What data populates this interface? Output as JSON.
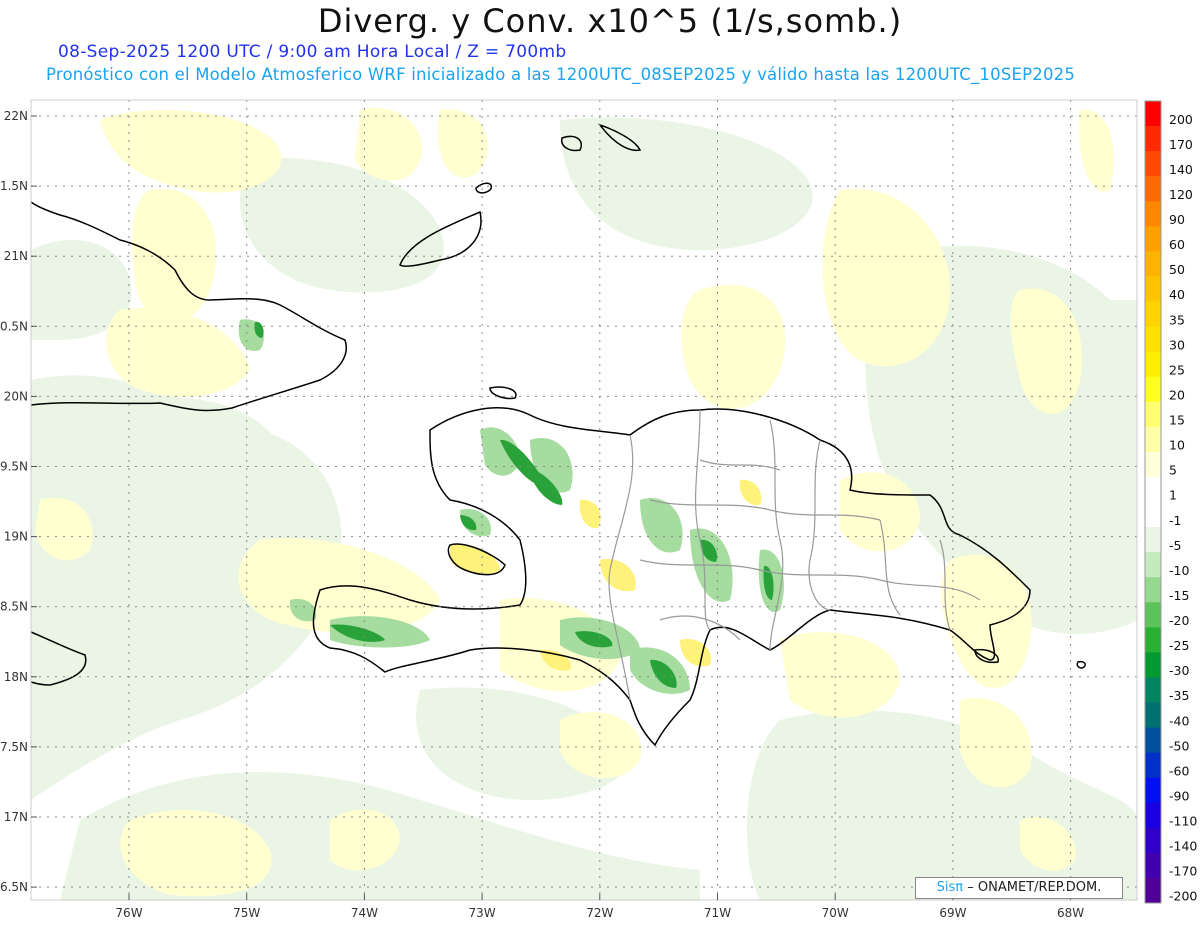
{
  "header": {
    "title": "Diverg. y Conv. x10^5 (1/s,somb.)",
    "line1": "08-Sep-2025  1200 UTC / 9:00 am Hora Local / Z = 700mb",
    "line2": "Pronóstico con el Modelo Atmosferico WRF inicializado a las 1200UTC_08SEP2025 y válido hasta las  1200UTC_10SEP2025"
  },
  "axes": {
    "lat_labels": [
      "22N",
      "1.5N",
      "21N",
      "0.5N",
      "20N",
      "9.5N",
      "19N",
      "8.5N",
      "18N",
      "7.5N",
      "17N",
      "6.5N"
    ],
    "lon_labels": [
      "76W",
      "75W",
      "74W",
      "73W",
      "72W",
      "71W",
      "70W",
      "69W",
      "68W"
    ]
  },
  "colorbar": {
    "labels": [
      "200",
      "170",
      "140",
      "120",
      "90",
      "60",
      "50",
      "40",
      "35",
      "30",
      "25",
      "20",
      "15",
      "10",
      "5",
      "1",
      "-1",
      "-5",
      "-10",
      "-15",
      "-20",
      "-25",
      "-30",
      "-35",
      "-40",
      "-50",
      "-60",
      "-90",
      "-110",
      "-140",
      "-170",
      "-200"
    ],
    "colors": [
      "#ff0000",
      "#ff2a00",
      "#ff4a00",
      "#ff6a00",
      "#ff8800",
      "#ffa000",
      "#ffb300",
      "#ffc400",
      "#ffd400",
      "#ffe000",
      "#ffee00",
      "#ffff20",
      "#ffff70",
      "#ffffa8",
      "#ffffd8",
      "#ffffff",
      "#ffffff",
      "#eaf5e5",
      "#c5eac0",
      "#95d98f",
      "#5cc45a",
      "#28b032",
      "#009a30",
      "#008560",
      "#007070",
      "#0050a0",
      "#0030c8",
      "#0010f0",
      "#1a00e0",
      "#3000c8",
      "#4000b0",
      "#500098"
    ]
  },
  "credit": {
    "brand": "Sisπ",
    "text": "– ONAMET/REP.DOM."
  }
}
